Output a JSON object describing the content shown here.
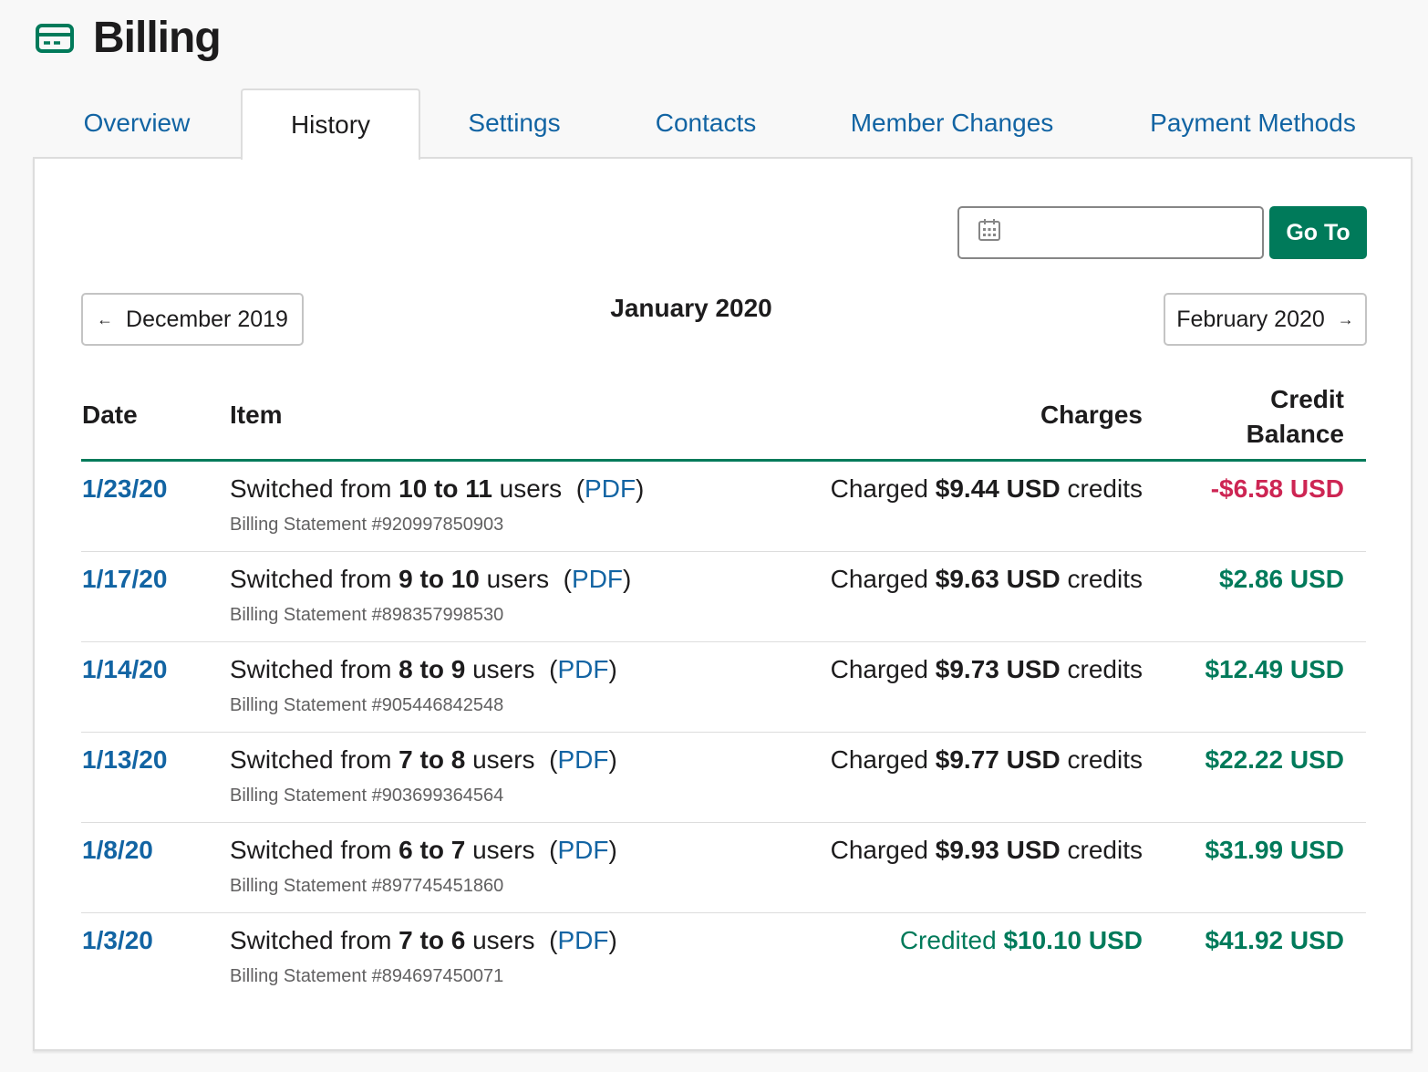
{
  "header": {
    "title": "Billing",
    "icon": "credit-card-icon",
    "icon_color": "#007a5a"
  },
  "tabs": [
    {
      "label": "Overview",
      "active": false
    },
    {
      "label": "History",
      "active": true
    },
    {
      "label": "Settings",
      "active": false
    },
    {
      "label": "Contacts",
      "active": false
    },
    {
      "label": "Member Changes",
      "active": false
    },
    {
      "label": "Payment Methods",
      "active": false
    }
  ],
  "goto": {
    "input_value": "",
    "button_label": "Go To"
  },
  "month_nav": {
    "prev_label": "December 2019",
    "current": "January 2020",
    "next_label": "February 2020"
  },
  "table": {
    "headers": {
      "date": "Date",
      "item": "Item",
      "charges": "Charges",
      "balance_line1": "Credit",
      "balance_line2": "Balance"
    },
    "rows": [
      {
        "date": "1/23/20",
        "prefix": "Switched from ",
        "change": "10 to 11",
        "suffix": " users",
        "pdf": "PDF",
        "statement": "Billing Statement #920997850903",
        "charge_word": "Charged ",
        "charge_amount": "$9.44 USD",
        "charge_suffix": " credits",
        "charge_type": "charged",
        "balance": "-$6.58 USD",
        "balance_color": "#cd2553"
      },
      {
        "date": "1/17/20",
        "prefix": "Switched from ",
        "change": "9 to 10",
        "suffix": " users",
        "pdf": "PDF",
        "statement": "Billing Statement #898357998530",
        "charge_word": "Charged ",
        "charge_amount": "$9.63 USD",
        "charge_suffix": " credits",
        "charge_type": "charged",
        "balance": "$2.86 USD",
        "balance_color": "#007a5a"
      },
      {
        "date": "1/14/20",
        "prefix": "Switched from ",
        "change": "8 to 9",
        "suffix": " users",
        "pdf": "PDF",
        "statement": "Billing Statement #905446842548",
        "charge_word": "Charged ",
        "charge_amount": "$9.73 USD",
        "charge_suffix": " credits",
        "charge_type": "charged",
        "balance": "$12.49 USD",
        "balance_color": "#007a5a"
      },
      {
        "date": "1/13/20",
        "prefix": "Switched from ",
        "change": "7 to 8",
        "suffix": " users",
        "pdf": "PDF",
        "statement": "Billing Statement #903699364564",
        "charge_word": "Charged ",
        "charge_amount": "$9.77 USD",
        "charge_suffix": " credits",
        "charge_type": "charged",
        "balance": "$22.22 USD",
        "balance_color": "#007a5a"
      },
      {
        "date": "1/8/20",
        "prefix": "Switched from ",
        "change": "6 to 7",
        "suffix": " users",
        "pdf": "PDF",
        "statement": "Billing Statement #897745451860",
        "charge_word": "Charged ",
        "charge_amount": "$9.93 USD",
        "charge_suffix": " credits",
        "charge_type": "charged",
        "balance": "$31.99 USD",
        "balance_color": "#007a5a"
      },
      {
        "date": "1/3/20",
        "prefix": "Switched from ",
        "change": "7 to 6",
        "suffix": " users",
        "pdf": "PDF",
        "statement": "Billing Statement #894697450071",
        "charge_word": "Credited ",
        "charge_amount": "$10.10 USD",
        "charge_suffix": "",
        "charge_type": "credited",
        "balance": "$41.92 USD",
        "balance_color": "#007a5a"
      }
    ]
  },
  "colors": {
    "link": "#1264a3",
    "accent": "#007a5a",
    "negative": "#cd2553"
  }
}
